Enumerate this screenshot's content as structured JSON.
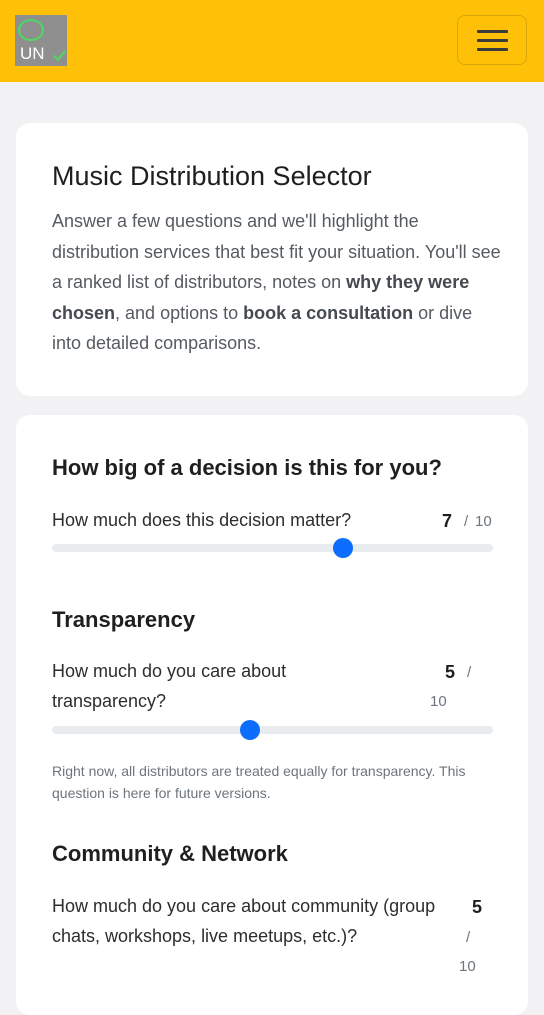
{
  "nav": {
    "logo_text": "UN",
    "menu_icon": "hamburger-menu-icon",
    "accent_color": "#ffc107"
  },
  "intro": {
    "title": "Music Distribution Selector",
    "p_part1": "Answer a few questions and we'll highlight the distribution services that best fit your situation. You'll see a ranked list of distributors, notes on ",
    "p_bold1": "why they were chosen",
    "p_part2": ", and options to ",
    "p_bold2": "book a consultation",
    "p_part3": " or dive into detailed comparisons."
  },
  "questions": [
    {
      "section": "How big of a decision is this for you?",
      "label": "How much does this decision matter?",
      "value": "7",
      "slash": "/",
      "max": "10",
      "fraction": 0.66
    },
    {
      "section": "Transparency",
      "label": "How much do you care about transparency?",
      "value": "5",
      "slash": "/",
      "max": "10",
      "fraction": 0.45,
      "note": "Right now, all distributors are treated equally for transparency. This question is here for future versions."
    },
    {
      "section": "Community & Network",
      "label": "How much do you care about community (group chats, workshops, live meetups, etc.)?",
      "value": "5",
      "slash": "/",
      "max": "10"
    }
  ],
  "colors": {
    "slider_thumb": "#0d6efd",
    "slider_track": "#e9ecef"
  }
}
